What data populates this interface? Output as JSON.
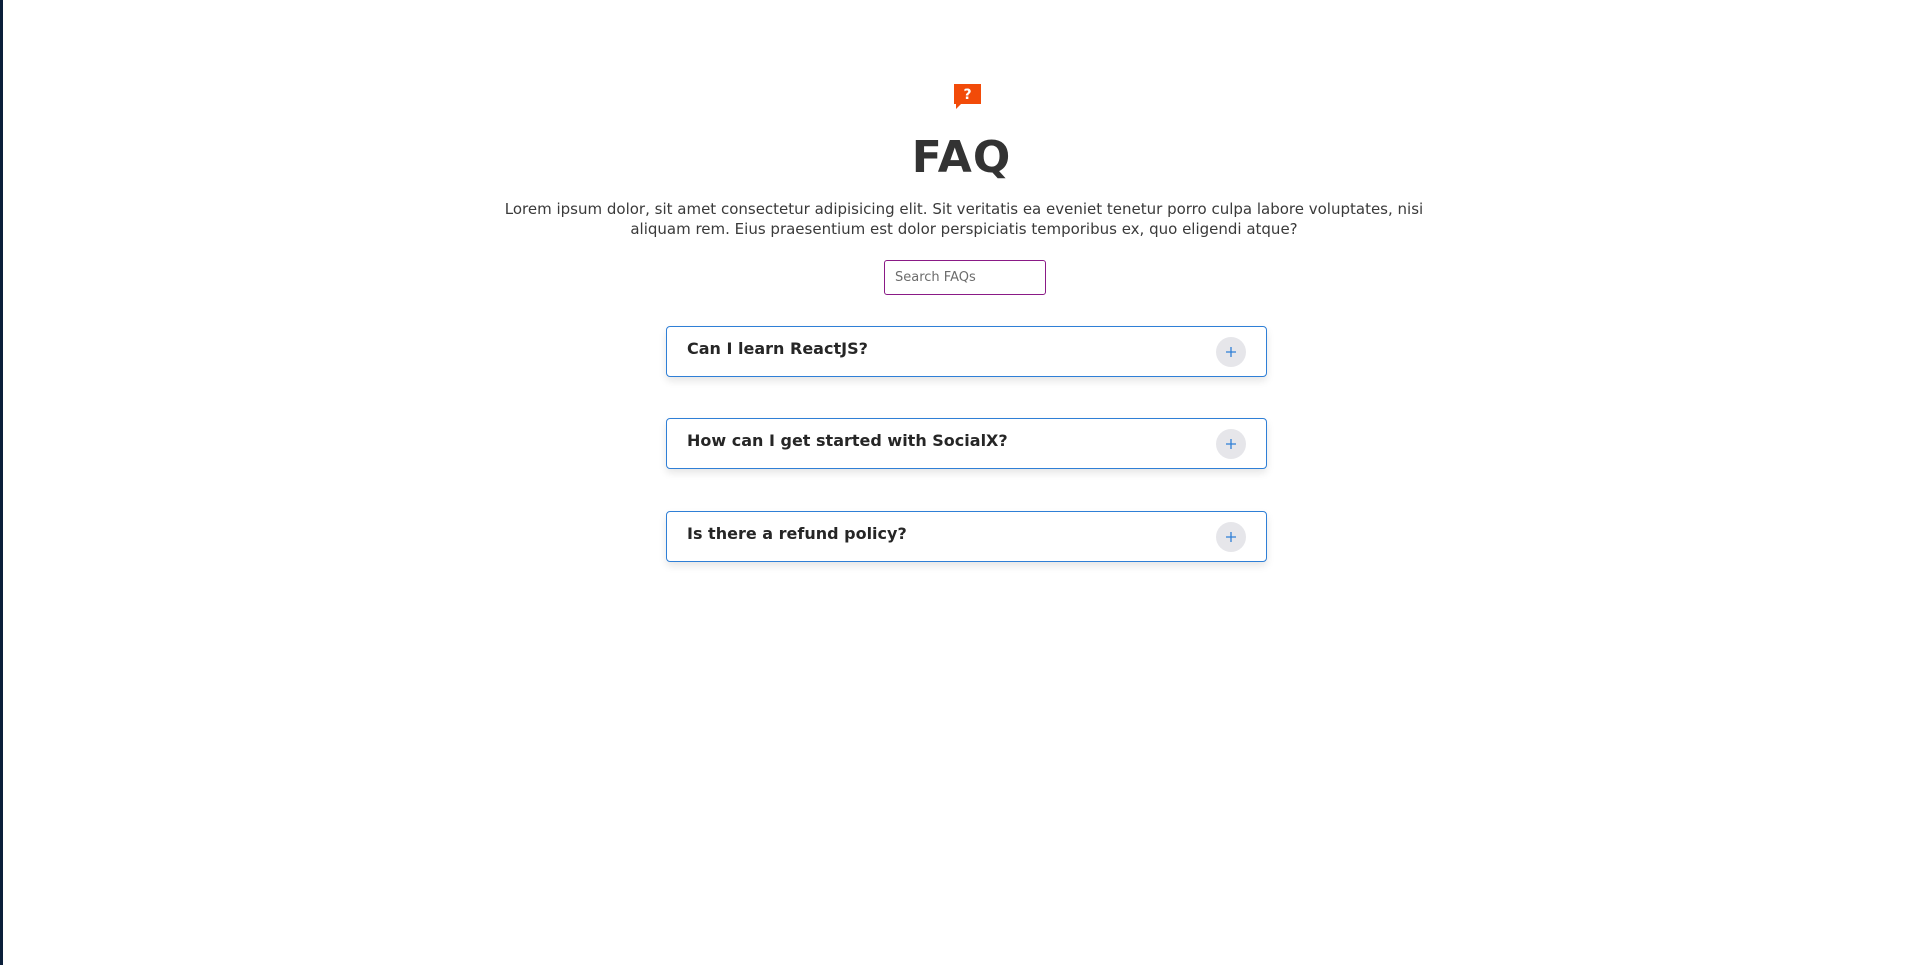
{
  "faq": {
    "icon": "question-bubble-icon",
    "icon_glyph": "?",
    "accent_color": "#f24b09",
    "title": "FAQ",
    "intro": "Lorem ipsum dolor, sit amet consectetur adipisicing elit. Sit veritatis ea eveniet tenetur porro culpa labore voluptates, nisi aliquam rem. Eius praesentium est dolor perspiciatis temporibus ex, quo eligendi atque?",
    "search": {
      "placeholder": "Search FAQs",
      "value": ""
    },
    "items": [
      {
        "question": "Can I learn ReactJS?",
        "toggle_icon": "plus-icon"
      },
      {
        "question": "How can I get started with SocialX?",
        "toggle_icon": "plus-icon"
      },
      {
        "question": "Is there a refund policy?",
        "toggle_icon": "plus-icon"
      }
    ],
    "item_border_color": "#2f7fd6",
    "search_border_color": "#8a1a86"
  }
}
